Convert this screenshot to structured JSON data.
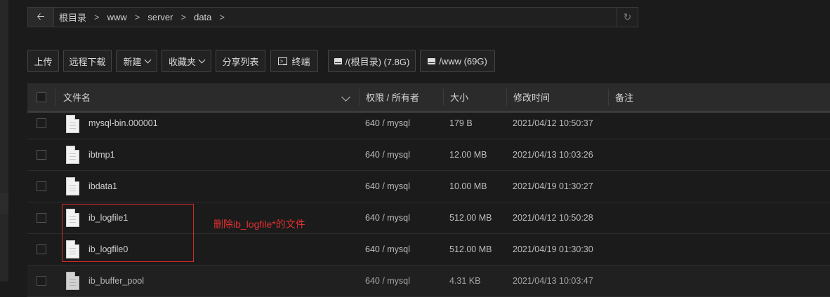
{
  "path": {
    "back_icon": "arrow-left",
    "crumbs": [
      "根目录",
      "www",
      "server",
      "data"
    ],
    "refresh_icon": "refresh"
  },
  "toolbar": {
    "upload": "上传",
    "remote_download": "远程下载",
    "new": "新建",
    "favorites": "收藏夹",
    "share_list": "分享列表",
    "terminal": "终端",
    "disk_root": "/(根目录) (7.8G)",
    "disk_www": "/www (69G)"
  },
  "table": {
    "headers": {
      "name": "文件名",
      "perm": "权限 / 所有者",
      "size": "大小",
      "mtime": "修改时间",
      "note": "备注"
    },
    "rows": [
      {
        "name": "mysql-bin.000001",
        "perm": "640 / mysql",
        "size": "179 B",
        "mtime": "2021/04/12 10:50:37"
      },
      {
        "name": "ibtmp1",
        "perm": "640 / mysql",
        "size": "12.00 MB",
        "mtime": "2021/04/13 10:03:26"
      },
      {
        "name": "ibdata1",
        "perm": "640 / mysql",
        "size": "10.00 MB",
        "mtime": "2021/04/19 01:30:27"
      },
      {
        "name": "ib_logfile1",
        "perm": "640 / mysql",
        "size": "512.00 MB",
        "mtime": "2021/04/12 10:50:28"
      },
      {
        "name": "ib_logfile0",
        "perm": "640 / mysql",
        "size": "512.00 MB",
        "mtime": "2021/04/19 01:30:30"
      },
      {
        "name": "ib_buffer_pool",
        "perm": "640 / mysql",
        "size": "4.31 KB",
        "mtime": "2021/04/13 10:03:47"
      }
    ]
  },
  "annotation": {
    "text": "删除ib_logfile*的文件",
    "color": "#e03030"
  }
}
